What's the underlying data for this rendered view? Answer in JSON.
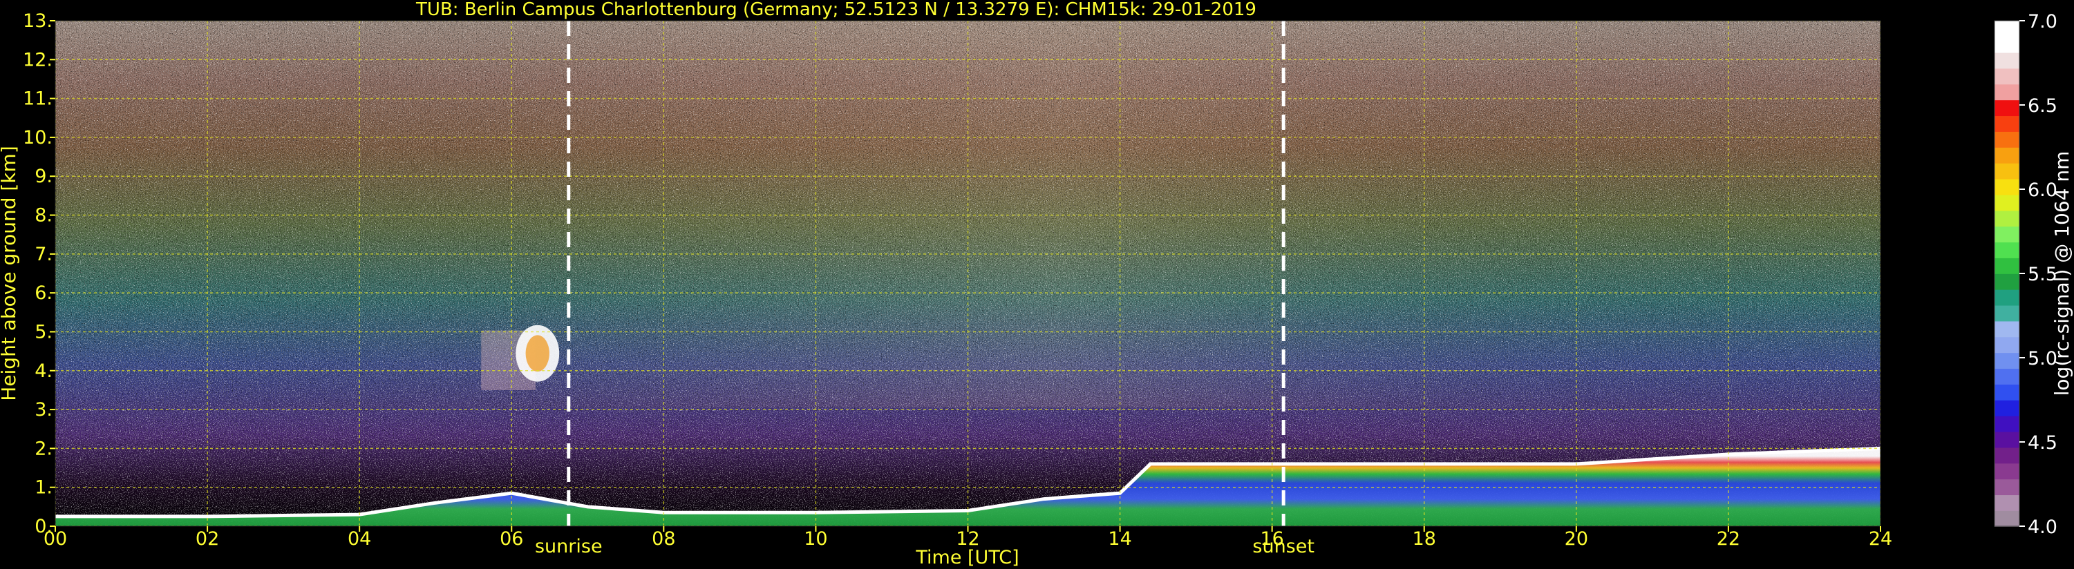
{
  "chart_data": {
    "type": "heatmap",
    "title": "TUB: Berlin Campus Charlottenburg (Germany; 52.5123 N / 13.3279 E):    CHM15k: 29-01-2019",
    "xlabel": "Time [UTC]",
    "ylabel": "Height above ground [km]",
    "xlim": [
      0,
      24
    ],
    "ylim": [
      0,
      13
    ],
    "x_ticks": [
      0,
      2,
      4,
      6,
      8,
      10,
      12,
      14,
      16,
      18,
      20,
      22,
      24
    ],
    "x_tick_labels": [
      "00",
      "02",
      "04",
      "06",
      "08",
      "10",
      "12",
      "14",
      "16",
      "18",
      "20",
      "22",
      "24"
    ],
    "y_ticks": [
      0,
      1,
      2,
      3,
      4,
      5,
      6,
      7,
      8,
      9,
      10,
      11,
      12,
      13
    ],
    "y_tick_labels": [
      "0.",
      "1.",
      "2.",
      "3.",
      "4.",
      "5.",
      "6.",
      "7.",
      "8.",
      "9.",
      "10.",
      "11.",
      "12.",
      "13."
    ],
    "grid": true,
    "vlines": [
      {
        "x": 6.75,
        "label": "sunrise"
      },
      {
        "x": 16.15,
        "label": "sunset"
      }
    ],
    "colorbar": {
      "label": "log(rc-signal) @ 1064 nm",
      "range": [
        4.0,
        7.0
      ],
      "ticks": [
        4.0,
        4.5,
        5.0,
        5.5,
        6.0,
        6.5,
        7.0
      ],
      "tick_labels": [
        "4.0",
        "4.5",
        "5.0",
        "5.5",
        "6.0",
        "6.5",
        "7.0"
      ],
      "colors": [
        "#a08ca0",
        "#b090b0",
        "#9a5a9a",
        "#8a3a90",
        "#72208a",
        "#5a10a0",
        "#4010c0",
        "#2020e0",
        "#3050f0",
        "#5070f0",
        "#7090f0",
        "#90a8f0",
        "#a0b8f0",
        "#40b0a0",
        "#20a080",
        "#20a040",
        "#30c040",
        "#50e050",
        "#80f060",
        "#b0f040",
        "#e0f020",
        "#f8e010",
        "#f8c010",
        "#f8a010",
        "#f87010",
        "#f84010",
        "#f01010",
        "#f0a0a0",
        "#f0c0c0",
        "#f0e0e0",
        "#ffffff",
        "#ffffff"
      ]
    },
    "layers": [
      {
        "name": "surface_layer",
        "points": [
          [
            0,
            0.25
          ],
          [
            2,
            0.25
          ],
          [
            4,
            0.3
          ],
          [
            5,
            0.6
          ],
          [
            6,
            0.85
          ],
          [
            7,
            0.5
          ],
          [
            8,
            0.35
          ],
          [
            10,
            0.35
          ],
          [
            12,
            0.4
          ],
          [
            13,
            0.7
          ],
          [
            14,
            0.85
          ],
          [
            14.4,
            1.6
          ],
          [
            18,
            1.6
          ],
          [
            20,
            1.6
          ],
          [
            22,
            1.85
          ],
          [
            24,
            2.0
          ]
        ]
      },
      {
        "name": "cloud_patch",
        "x": [
          5.6,
          6.9
        ],
        "y": [
          3.5,
          6.1
        ]
      }
    ]
  }
}
